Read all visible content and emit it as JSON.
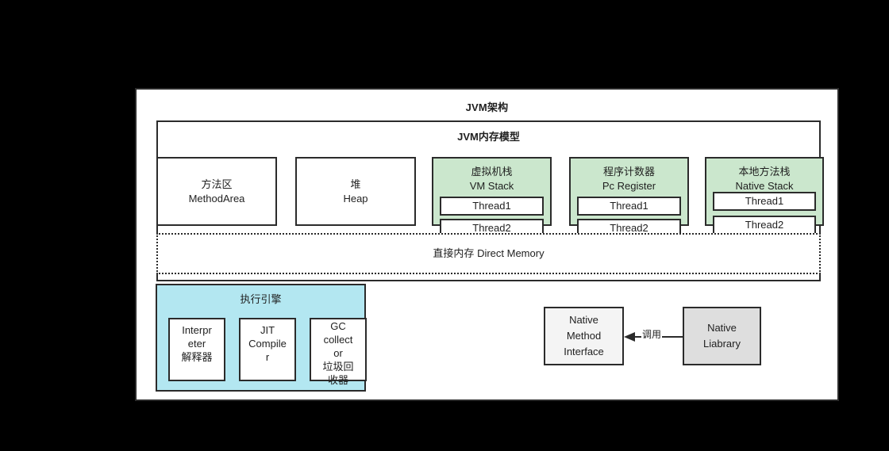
{
  "diagram": {
    "title": "JVM架构",
    "memory_model": {
      "title": "JVM内存模型",
      "regions": [
        {
          "cn": "方法区",
          "en": "MethodArea",
          "style": "plain"
        },
        {
          "cn": "堆",
          "en": "Heap",
          "style": "plain"
        },
        {
          "cn": "虚拟机栈",
          "en": "VM Stack",
          "style": "green",
          "threads": [
            "Thread1",
            "Thread2"
          ]
        },
        {
          "cn": "程序计数器",
          "en": "Pc Register",
          "style": "green",
          "threads": [
            "Thread1",
            "Thread2"
          ]
        },
        {
          "cn": "本地方法栈",
          "en": "Native Stack",
          "style": "green",
          "threads": [
            "Thread1",
            "Thread2"
          ]
        }
      ],
      "direct_memory": {
        "cn": "直接内存",
        "en": "Direct Memory"
      }
    },
    "execution_engine": {
      "title": "执行引擎",
      "items": [
        {
          "lines": [
            "Interpr",
            "eter",
            "解释器"
          ]
        },
        {
          "lines": [
            "JIT",
            "Compile",
            "r"
          ]
        },
        {
          "lines": [
            "GC",
            "collect",
            "or",
            "垃圾回",
            "收器"
          ]
        }
      ]
    },
    "native": {
      "interface": {
        "lines": [
          "Native",
          "Method",
          "Interface"
        ]
      },
      "library": {
        "lines": [
          "Native",
          "Liabrary"
        ]
      },
      "call_label": "调用"
    },
    "colors": {
      "green_fill": "#cbe7cd",
      "blue_fill": "#b3e7f1",
      "gray_fill": "#dedede",
      "light_fill": "#f4f4f4",
      "stroke": "#2b2b2b",
      "background": "#000000",
      "panel": "#ffffff"
    }
  }
}
